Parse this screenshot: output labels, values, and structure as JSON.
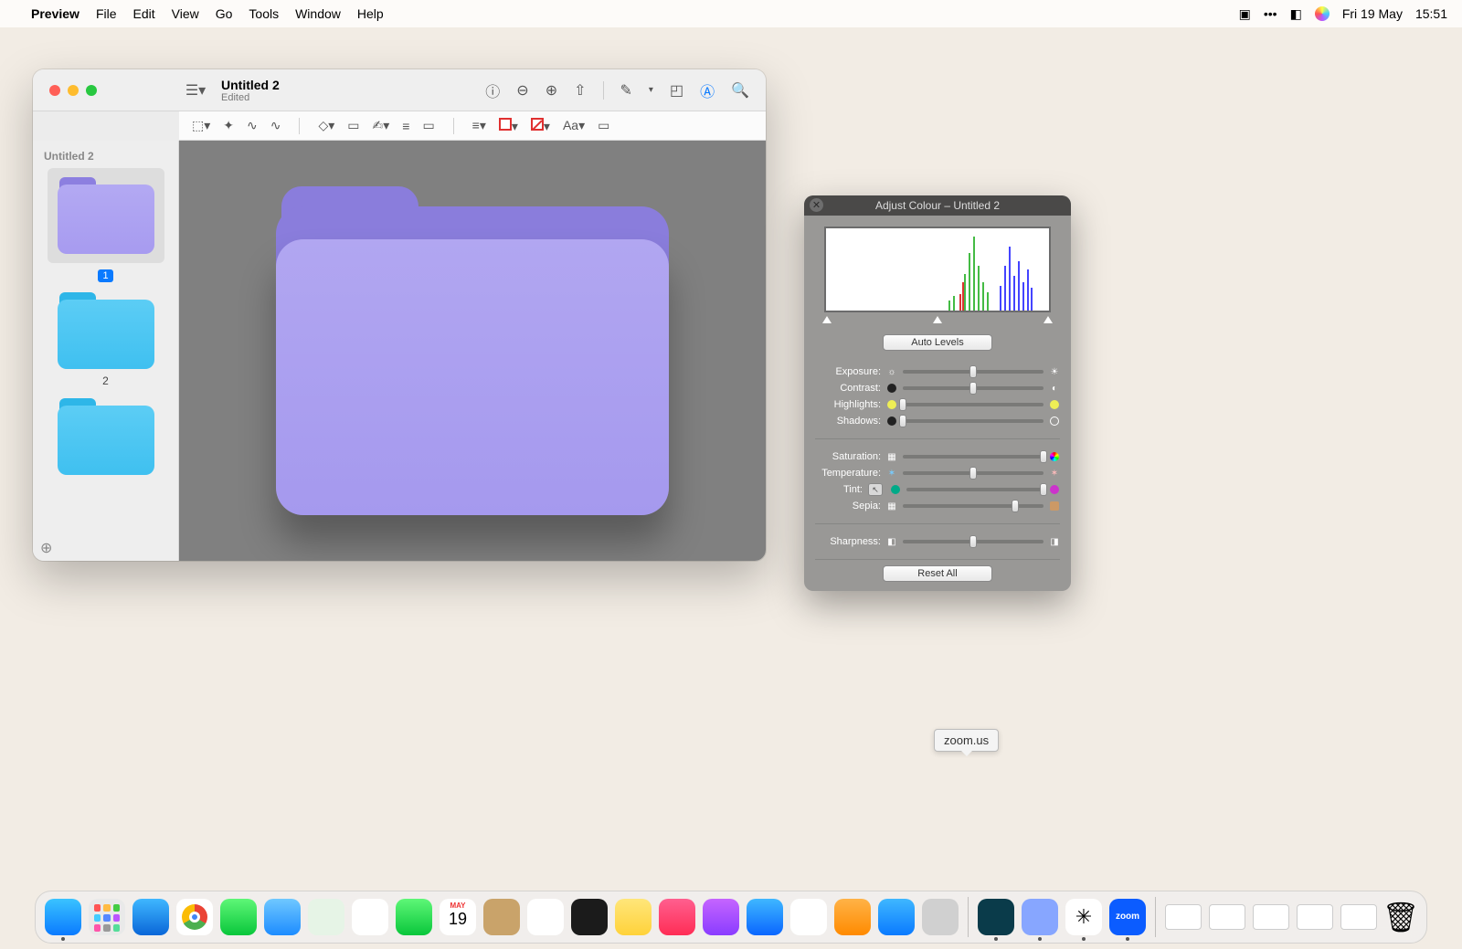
{
  "menubar": {
    "app": "Preview",
    "items": [
      "File",
      "Edit",
      "View",
      "Go",
      "Tools",
      "Window",
      "Help"
    ],
    "date": "Fri 19 May",
    "time": "15:51"
  },
  "preview": {
    "title": "Untitled 2",
    "subtitle": "Edited",
    "sidebar_title": "Untitled 2",
    "pages": [
      "1",
      "2"
    ],
    "text_tool_label": "Aa"
  },
  "adjust": {
    "title": "Adjust Colour – Untitled 2",
    "auto_levels": "Auto Levels",
    "reset_all": "Reset All",
    "sliders": {
      "exposure": {
        "label": "Exposure:",
        "pos": 50
      },
      "contrast": {
        "label": "Contrast:",
        "pos": 50
      },
      "highlights": {
        "label": "Highlights:",
        "pos": 0
      },
      "shadows": {
        "label": "Shadows:",
        "pos": 0
      },
      "saturation": {
        "label": "Saturation:",
        "pos": 100
      },
      "temperature": {
        "label": "Temperature:",
        "pos": 50
      },
      "tint": {
        "label": "Tint:",
        "pos": 100
      },
      "sepia": {
        "label": "Sepia:",
        "pos": 80
      },
      "sharpness": {
        "label": "Sharpness:",
        "pos": 50
      }
    }
  },
  "tooltip": {
    "text": "zoom.us"
  },
  "dock": {
    "apps": [
      {
        "name": "finder",
        "bg": "linear-gradient(#3ac3ff,#0a7aff)",
        "dot": true
      },
      {
        "name": "launchpad",
        "bg": "#e9e9e9"
      },
      {
        "name": "safari",
        "bg": "linear-gradient(#3fb7ff,#0a66d8)"
      },
      {
        "name": "chrome",
        "bg": "#fff"
      },
      {
        "name": "messages",
        "bg": "linear-gradient(#5ef777,#09c63b)"
      },
      {
        "name": "mail",
        "bg": "linear-gradient(#6fc8ff,#1d8cff)"
      },
      {
        "name": "maps",
        "bg": "#e6f4e6"
      },
      {
        "name": "photos",
        "bg": "#fff"
      },
      {
        "name": "facetime",
        "bg": "linear-gradient(#5ef777,#09c63b)"
      },
      {
        "name": "calendar",
        "bg": "#fff",
        "dot": false
      },
      {
        "name": "contacts",
        "bg": "#c9a36a"
      },
      {
        "name": "reminders",
        "bg": "#fff"
      },
      {
        "name": "tv",
        "bg": "#1b1b1b"
      },
      {
        "name": "notes",
        "bg": "linear-gradient(#ffe67a,#ffd23a)"
      },
      {
        "name": "music",
        "bg": "linear-gradient(#ff5f8f,#ff2d55)"
      },
      {
        "name": "podcasts",
        "bg": "linear-gradient(#c565ff,#8a3cff)"
      },
      {
        "name": "appstore",
        "bg": "linear-gradient(#3fb7ff,#0a66ff)"
      },
      {
        "name": "numbers",
        "bg": "#fff"
      },
      {
        "name": "pages",
        "bg": "linear-gradient(#ffb347,#ff8a00)"
      },
      {
        "name": "appstore2",
        "bg": "linear-gradient(#3fb7ff,#0a7aff)"
      },
      {
        "name": "settings",
        "bg": "#d0d0d0"
      }
    ],
    "pinned": [
      {
        "name": "app-a",
        "bg": "#0a3b4a",
        "dot": true
      },
      {
        "name": "preview",
        "bg": "#87a6ff",
        "dot": true
      },
      {
        "name": "slack",
        "bg": "#fff",
        "dot": true
      },
      {
        "name": "zoom",
        "bg": "#0b5cff",
        "dot": true
      }
    ],
    "calendar_month": "MAY",
    "calendar_day": "19"
  }
}
